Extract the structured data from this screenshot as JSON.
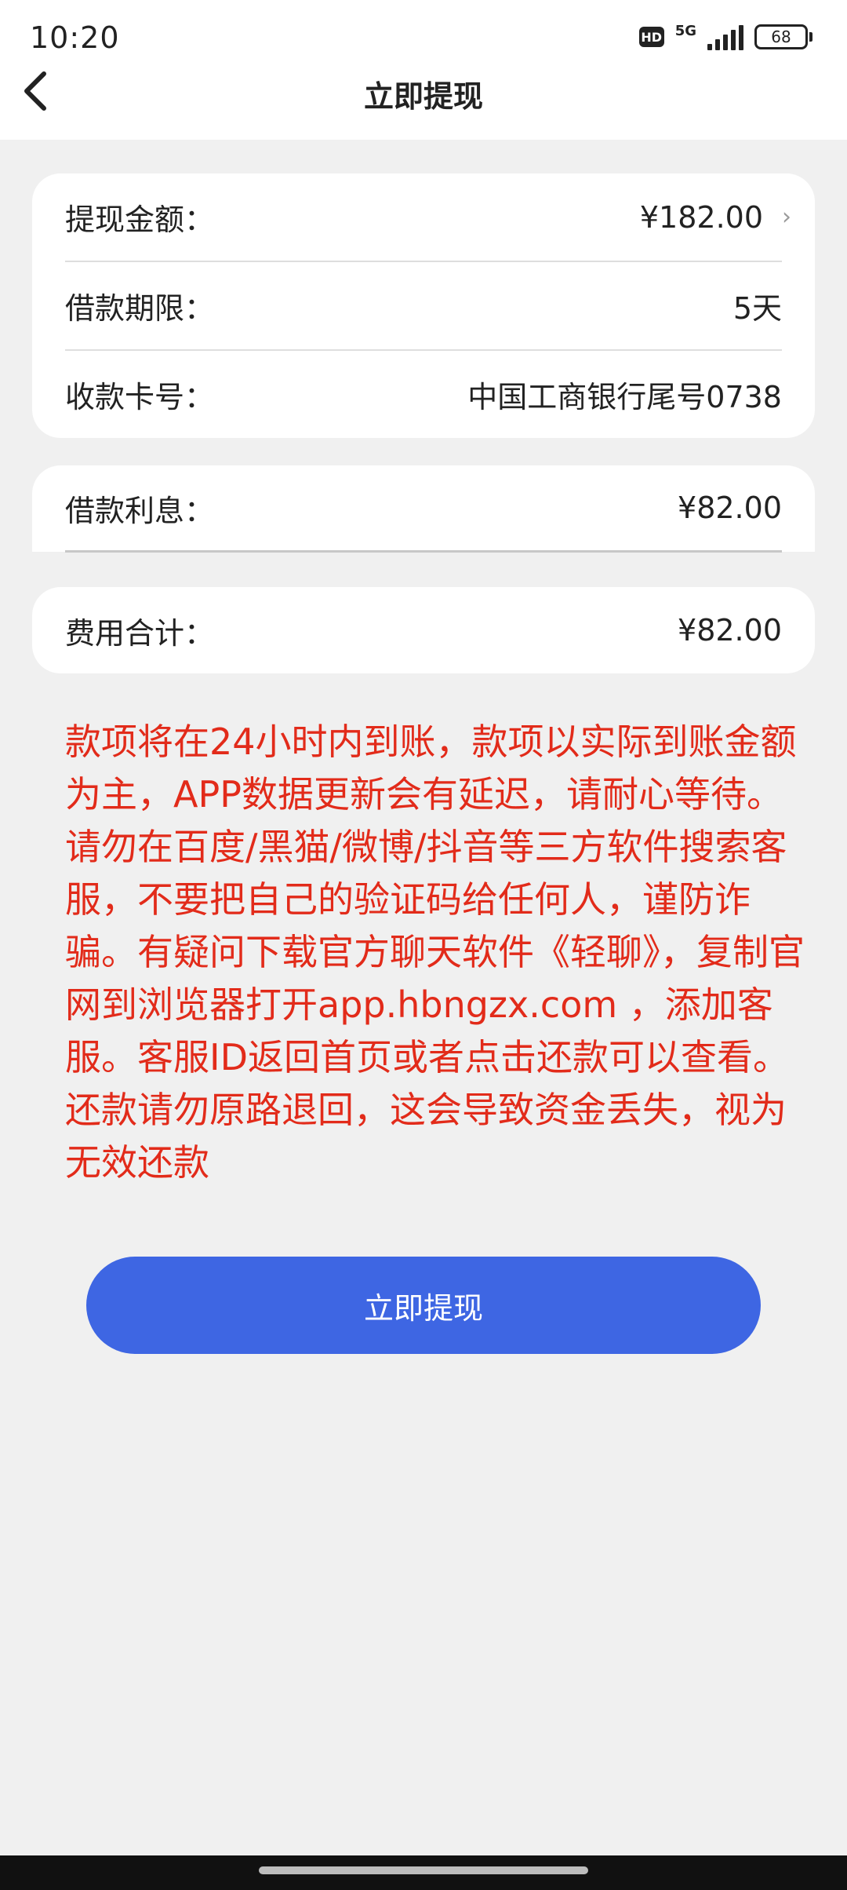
{
  "status_bar": {
    "time": "10:20",
    "hd_badge": "HD",
    "network": "5G",
    "battery": "68"
  },
  "header": {
    "title": "立即提现",
    "back_icon": "chevron-left-icon"
  },
  "withdraw_card": {
    "amount_label": "提现金额：",
    "amount_value": "¥182.00",
    "term_label": "借款期限：",
    "term_value": "5天",
    "account_label": "收款卡号：",
    "account_value": "中国工商银行尾号0738"
  },
  "interest_card": {
    "label": "借款利息：",
    "value": "¥82.00"
  },
  "total_card": {
    "label": "费用合计：",
    "value": "¥82.00"
  },
  "notice": {
    "text": "款项将在24小时内到账，款项以实际到账金额为主，APP数据更新会有延迟，请耐心等待。请勿在百度/黑猫/微博/抖音等三方软件搜索客服，不要把自己的验证码给任何人，谨防诈骗。有疑问下载官方聊天软件《轻聊》，复制官网到浏览器打开app.hbngzx.com ，添加客服。客服ID返回首页或者点击还款可以查看。还款请勿原路退回，这会导致资金丢失，视为无效还款",
    "color": "#e22b1a"
  },
  "submit": {
    "label": "立即提现",
    "color": "#3e66e3"
  }
}
